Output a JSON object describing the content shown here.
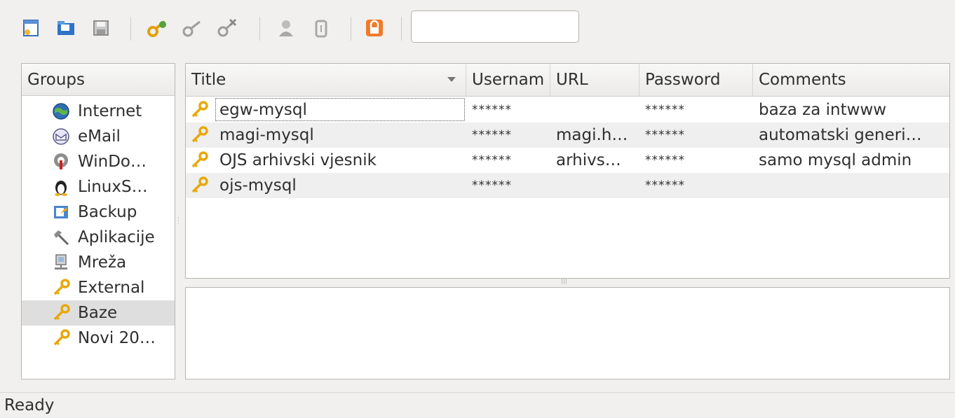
{
  "toolbar": {
    "buttons": [
      {
        "name": "new-database-icon"
      },
      {
        "name": "open-database-icon"
      },
      {
        "name": "save-database-icon"
      },
      {
        "name": "add-entry-icon"
      },
      {
        "name": "edit-entry-icon"
      },
      {
        "name": "delete-entry-icon"
      },
      {
        "name": "copy-username-icon"
      },
      {
        "name": "copy-password-icon"
      },
      {
        "name": "lock-workspace-icon"
      }
    ],
    "search_value": ""
  },
  "groups": {
    "header": "Groups",
    "items": [
      {
        "label": "Internet",
        "icon": "globe-icon"
      },
      {
        "label": "eMail",
        "icon": "envelope-icon"
      },
      {
        "label": "WinDo…",
        "icon": "windows-key-icon"
      },
      {
        "label": "LinuxS…",
        "icon": "tux-icon"
      },
      {
        "label": "Backup",
        "icon": "backup-icon"
      },
      {
        "label": "Aplikacije",
        "icon": "hammer-icon"
      },
      {
        "label": "Mreža",
        "icon": "network-icon"
      },
      {
        "label": "External",
        "icon": "key-icon"
      },
      {
        "label": "Baze",
        "icon": "key-icon"
      },
      {
        "label": "Novi 20…",
        "icon": "key-icon"
      }
    ],
    "selected": "Baze"
  },
  "entries": {
    "columns": [
      "Title",
      "Usernam",
      "URL",
      "Password",
      "Comments"
    ],
    "rows": [
      {
        "title": "egw-mysql",
        "username": "******",
        "url": "",
        "password": "******",
        "comments": "baza za intwww"
      },
      {
        "title": "magi-mysql",
        "username": "******",
        "url": "magi.h…",
        "password": "******",
        "comments": "automatski generi…"
      },
      {
        "title": "OJS arhivski vjesnik",
        "username": "******",
        "url": "arhivs…",
        "password": "******",
        "comments": "samo mysql admin"
      },
      {
        "title": "ojs-mysql",
        "username": "******",
        "url": "",
        "password": "******",
        "comments": ""
      }
    ]
  },
  "status": {
    "text": "Ready"
  },
  "colors": {
    "key_gold": "#e8a80c",
    "selected_row": "#dedede",
    "alt_row": "#efefef"
  }
}
